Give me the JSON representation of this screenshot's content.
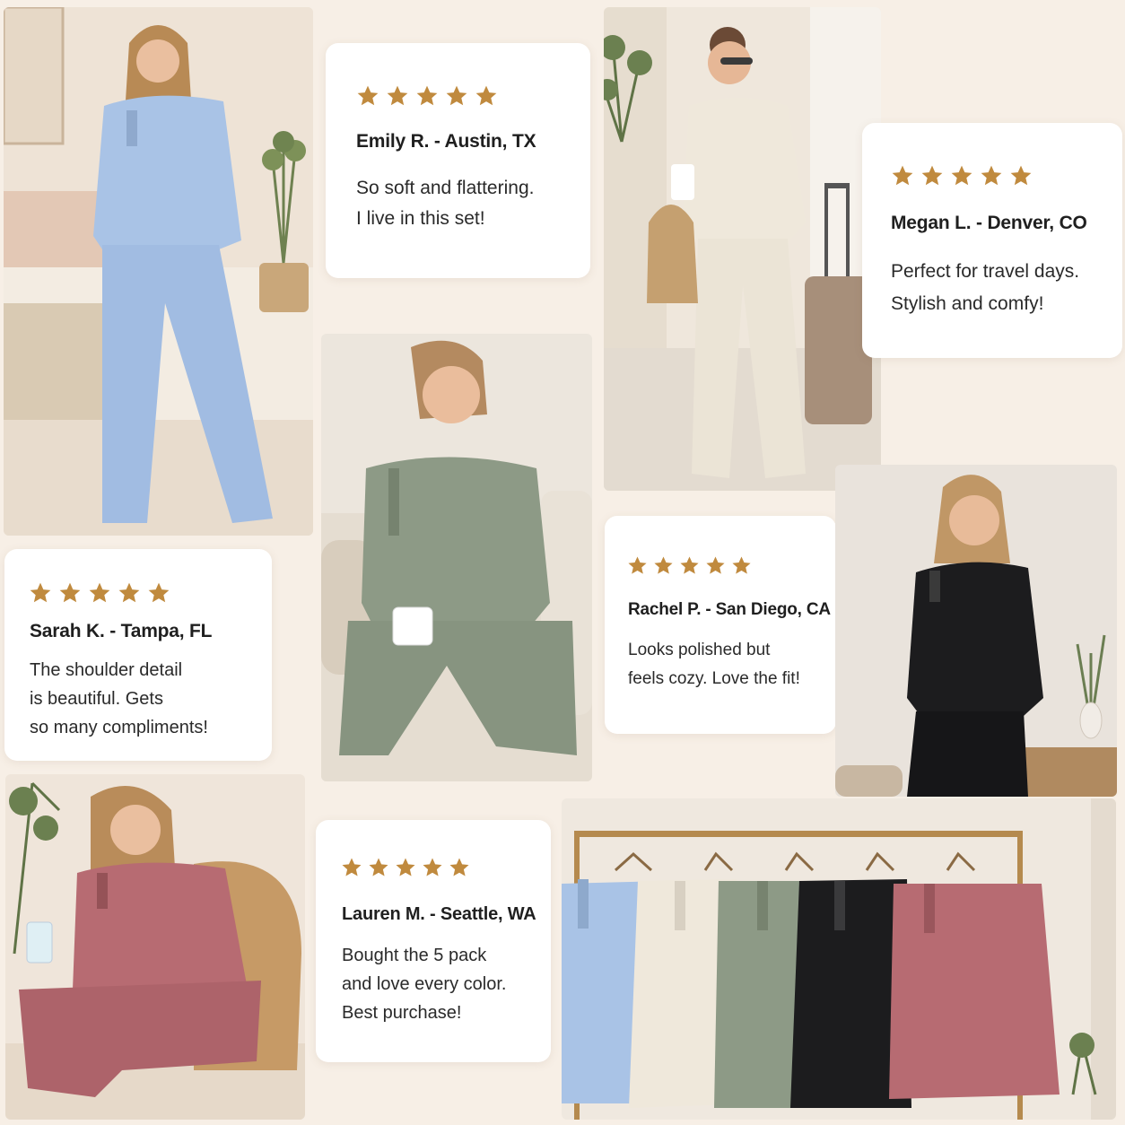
{
  "colors": {
    "background": "#f7efe6",
    "star": "#c08a3e",
    "blue": "#a9c3e6",
    "cream": "#efe8db",
    "sage": "#8d9a86",
    "black": "#1c1c1e",
    "rose": "#b76b72"
  },
  "reviews": [
    {
      "stars": 5,
      "name": "Emily R. - Austin, TX",
      "text": "So soft and flattering.\nI live in this set!"
    },
    {
      "stars": 5,
      "name": "Megan L. - Denver, CO",
      "text": "Perfect for travel days.\nStylish and comfy!"
    },
    {
      "stars": 5,
      "name": "Sarah K. - Tampa, FL",
      "text": "The shoulder detail\nis beautiful. Gets\nso many compliments!"
    },
    {
      "stars": 5,
      "name": "Rachel P. - San Diego, CA",
      "text": "Looks polished but\nfeels cozy. Love the fit!"
    },
    {
      "stars": 5,
      "name": "Lauren M. - Seattle, WA",
      "text": "Bought the 5 pack\nand love every color.\nBest purchase!"
    }
  ],
  "icons": {
    "star": "star-icon"
  }
}
